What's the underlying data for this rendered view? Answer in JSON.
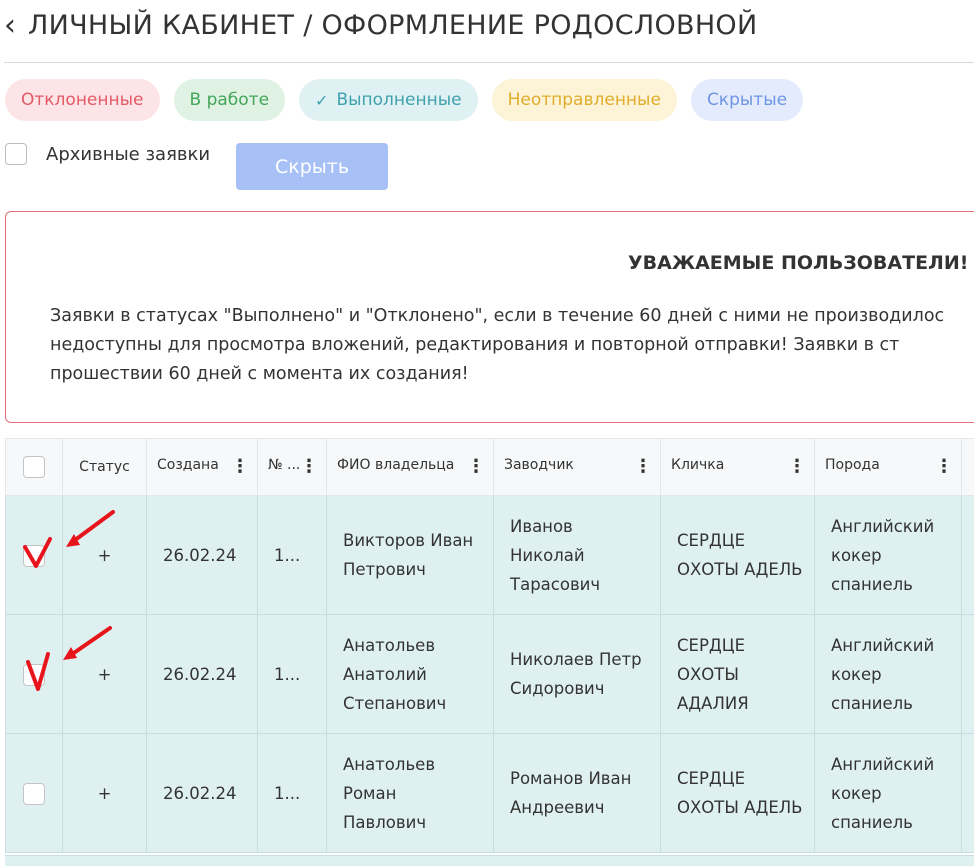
{
  "header": {
    "back_glyph": "‹",
    "title": "ЛИЧНЫЙ КАБИНЕТ / ОФОРМЛЕНИЕ РОДОСЛОВНОЙ"
  },
  "filters": [
    {
      "label": "Отклоненные",
      "color": "#e25a66",
      "selected": false
    },
    {
      "label": "В работе",
      "color": "#43a55a",
      "selected": false
    },
    {
      "label": "Выполненные",
      "color": "#3fa1ae",
      "selected": true
    },
    {
      "label": "Неотправленные",
      "color": "#e0ad2c",
      "selected": false
    },
    {
      "label": "Скрытые",
      "color": "#6f95e4",
      "selected": false
    }
  ],
  "archive": {
    "label": "Архивные заявки",
    "checked": false
  },
  "hide_button": {
    "label": "Скрыть",
    "color": "#a7c1f7"
  },
  "notice": {
    "title": "УВАЖАЕМЫЕ ПОЛЬЗОВАТЕЛИ!",
    "lines": [
      "Заявки в статусах \"Выполнено\" и \"Отклонено\", если в течение 60 дней с ними не производилос",
      "недоступны для просмотра вложений, редактирования и повторной отправки! Заявки в ст",
      "прошествии 60 дней с момента их создания!"
    ]
  },
  "table": {
    "columns": [
      "Статус",
      "Создана",
      "№ ...",
      "ФИО владельца",
      "Заводчик",
      "Кличка",
      "Порода"
    ],
    "rows": [
      {
        "checked": true,
        "status": "+",
        "created": "26.02.24",
        "number": "1...",
        "owner": "Викторов Иван Петрович",
        "breeder": "Иванов Николай Тарасович",
        "name": "СЕРДЦЕ ОХОТЫ АДЕЛЬ",
        "breed": "Английский кокер спаниель"
      },
      {
        "checked": true,
        "status": "+",
        "created": "26.02.24",
        "number": "1...",
        "owner": "Анатольев Анатолий Степанович",
        "breeder": "Николаев Петр Сидорович",
        "name": "СЕРДЦЕ ОХОТЫ АДАЛИЯ",
        "breed": "Английский кокер спаниель"
      },
      {
        "checked": false,
        "status": "+",
        "created": "26.02.24",
        "number": "1...",
        "owner": "Анатольев Роман Павлович",
        "breeder": "Романов Иван Андреевич",
        "name": "СЕРДЦЕ ОХОТЫ АДЕЛЬ",
        "breed": "Английский кокер спаниель"
      }
    ]
  },
  "annotation_color": "#e8141c"
}
